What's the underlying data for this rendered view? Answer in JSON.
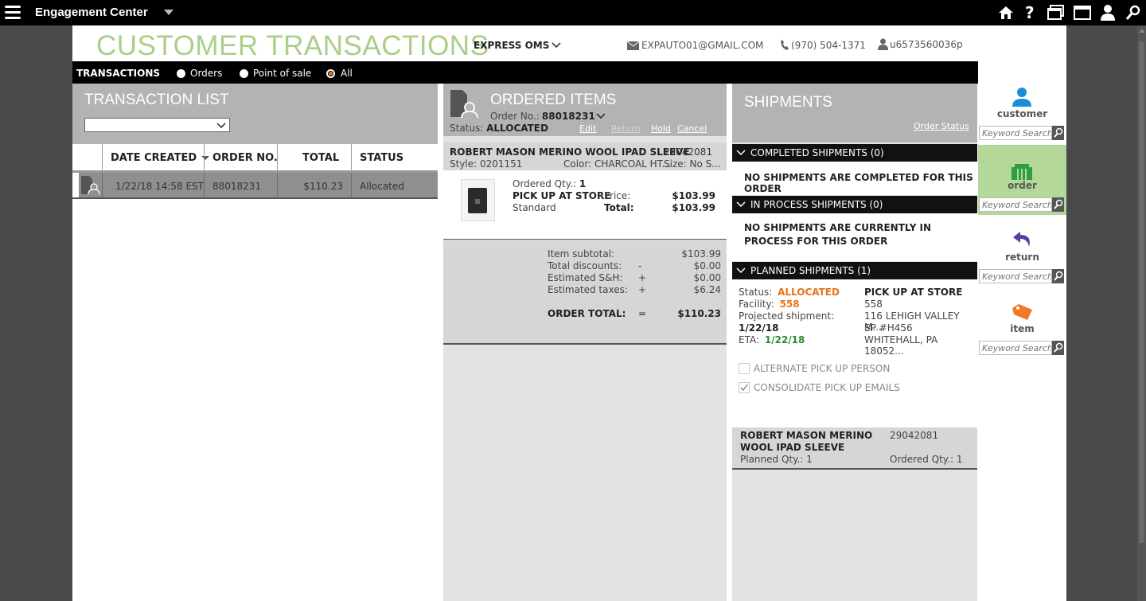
{
  "app": {
    "title": "Engagement Center"
  },
  "header": {
    "page_title": "CUSTOMER TRANSACTIONS",
    "store": "EXPRESS OMS",
    "email": "EXPAUTO01@GMAIL.COM",
    "phone": "(970) 504-1371",
    "user": "u6573560036p"
  },
  "filter": {
    "label": "TRANSACTIONS",
    "options": [
      "Orders",
      "Point of sale",
      "All"
    ],
    "selected": "All"
  },
  "transaction_list": {
    "title": "TRANSACTION LIST",
    "columns": [
      "DATE CREATED",
      "ORDER NO.",
      "TOTAL",
      "STATUS"
    ],
    "rows": [
      {
        "date": "1/22/18 14:58 EST",
        "order_no": "88018231",
        "total": "$110.23",
        "status": "Allocated"
      }
    ]
  },
  "ordered_items": {
    "title": "ORDERED ITEMS",
    "order_no_label": "Order No.:",
    "order_no": "88018231",
    "status_label": "Status:",
    "status": "ALLOCATED",
    "actions": [
      "Edit",
      "Return",
      "Hold",
      "Cancel"
    ],
    "item": {
      "name": "ROBERT MASON MERINO WOOL IPAD SLEEVE",
      "sku": "29042081",
      "style": "Style: 0201151",
      "color": "Color:  CHARCOAL HT...",
      "size": "Size:  No S...",
      "qty_label": "Ordered Qty.:",
      "qty": "1",
      "fulfillment": "PICK UP AT STORE",
      "shipping": "Standard",
      "price_label": "Price:",
      "price": "$103.99",
      "total_label": "Total:",
      "total": "$103.99"
    },
    "summary": [
      {
        "label": "Item subtotal:",
        "op": "",
        "value": "$103.99"
      },
      {
        "label": "Total discounts:",
        "op": "-",
        "value": "$0.00"
      },
      {
        "label": "Estimated S&H:",
        "op": "+",
        "value": "$0.00"
      },
      {
        "label": "Estimated taxes:",
        "op": "+",
        "value": "$6.24"
      }
    ],
    "order_total_label": "ORDER TOTAL:",
    "order_total_op": "=",
    "order_total": "$110.23"
  },
  "shipments": {
    "title": "SHIPMENTS",
    "order_status_link": "Order Status",
    "completed_header": "COMPLETED SHIPMENTS (0)",
    "completed_msg": "NO SHIPMENTS ARE COMPLETED FOR THIS ORDER",
    "in_process_header": "IN PROCESS SHIPMENTS (0)",
    "in_process_msg": "NO SHIPMENTS ARE CURRENTLY IN PROCESS FOR THIS ORDER",
    "planned_header": "PLANNED SHIPMENTS (1)",
    "status_label": "Status:",
    "status": "ALLOCATED",
    "facility_label": "Facility:",
    "facility": "558",
    "projected_label": "Projected shipment:",
    "projected": "1/22/18",
    "eta_label": "ETA:",
    "eta": "1/22/18",
    "pickup_label": "PICK UP AT STORE",
    "addr1": "558",
    "addr2": "116 LEHIGH VALLEY M...",
    "addr3": "SP #H456",
    "addr4": "WHITEHALL, PA 18052...",
    "alt_pickup": "ALTERNATE PICK UP PERSON",
    "consolidate": "CONSOLIDATE PICK UP EMAILS",
    "item_name_1": "ROBERT MASON MERINO",
    "item_name_2": "WOOL IPAD SLEEVE",
    "item_sku": "29042081",
    "planned_qty": "Planned Qty.:  1",
    "ordered_qty": "Ordered Qty.:  1"
  },
  "sidebar": {
    "items": [
      {
        "label": "customer",
        "color": "#1a8fd6"
      },
      {
        "label": "order",
        "color": "#2e9e3e"
      },
      {
        "label": "return",
        "color": "#5b3fa0"
      },
      {
        "label": "item",
        "color": "#f07a2a"
      }
    ],
    "search_placeholder": "Keyword Search"
  },
  "colors": {
    "accent_green": "#a9cf88",
    "accent_orange": "#e8741b",
    "eta_green": "#2e8b2e"
  }
}
